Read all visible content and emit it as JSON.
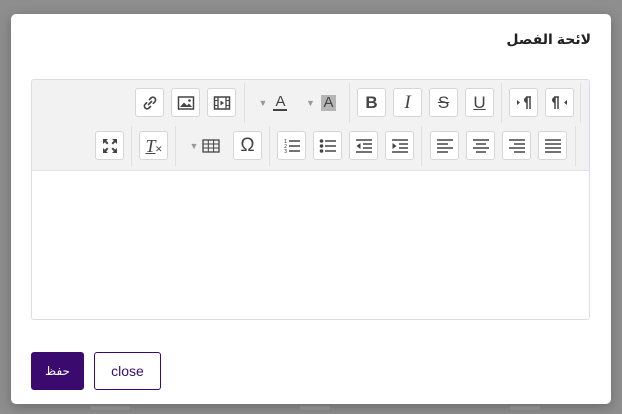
{
  "modal": {
    "title": "لائحة الفصل",
    "save_label": "حفظ",
    "close_label": "close"
  },
  "editor": {
    "content": "",
    "toolbar_row1": [
      {
        "name": "link",
        "icon": "link-icon"
      },
      {
        "name": "image",
        "icon": "image-icon"
      },
      {
        "name": "video",
        "icon": "video-icon"
      },
      {
        "name": "font-color",
        "icon": "font-color-icon",
        "label": "A"
      },
      {
        "name": "background-color",
        "icon": "highlight-icon",
        "label": "A"
      },
      {
        "name": "bold",
        "icon": "bold-icon",
        "label": "B"
      },
      {
        "name": "italic",
        "icon": "italic-icon",
        "label": "I"
      },
      {
        "name": "strikethrough",
        "icon": "strikethrough-icon",
        "label": "S"
      },
      {
        "name": "underline",
        "icon": "underline-icon",
        "label": "U"
      },
      {
        "name": "ltr",
        "icon": "paragraph-ltr-icon"
      },
      {
        "name": "rtl",
        "icon": "paragraph-rtl-icon"
      }
    ],
    "toolbar_row2": [
      {
        "name": "fullscreen",
        "icon": "fullscreen-icon"
      },
      {
        "name": "clear-format",
        "icon": "clear-format-icon",
        "label": "T"
      },
      {
        "name": "table",
        "icon": "table-icon"
      },
      {
        "name": "special-char",
        "icon": "omega-icon",
        "label": "Ω"
      },
      {
        "name": "ordered-list",
        "icon": "ordered-list-icon"
      },
      {
        "name": "unordered-list",
        "icon": "unordered-list-icon"
      },
      {
        "name": "outdent",
        "icon": "outdent-icon"
      },
      {
        "name": "indent",
        "icon": "indent-icon"
      },
      {
        "name": "align-left",
        "icon": "align-left-icon"
      },
      {
        "name": "align-center",
        "icon": "align-center-icon"
      },
      {
        "name": "align-right",
        "icon": "align-right-icon"
      },
      {
        "name": "justify",
        "icon": "justify-icon"
      }
    ]
  },
  "colors": {
    "primary": "#3b0a6e",
    "overlay": "#8e8e8e",
    "toolbar_bg": "#f2f2f2"
  }
}
